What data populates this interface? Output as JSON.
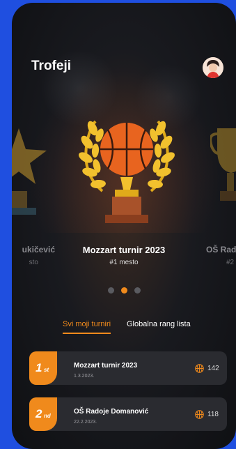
{
  "header": {
    "title": "Trofeji",
    "avatar_icon": "user-avatar-icon"
  },
  "carousel": {
    "left": {
      "title": "ukičević",
      "subtitle": "sto"
    },
    "center": {
      "title": "Mozzart turnir 2023",
      "subtitle": "#1 mesto"
    },
    "right": {
      "title": "OŠ Radoj",
      "subtitle": "#2"
    },
    "active_index": 1,
    "dot_count": 3
  },
  "tabs": {
    "my_tournaments": "Svi moji turniri",
    "global_ranking": "Globalna rang lista"
  },
  "list": [
    {
      "rank": "1",
      "suffix": "st",
      "name": "Mozzart turnir 2023",
      "date": "1.3.2023.",
      "points": "142"
    },
    {
      "rank": "2",
      "suffix": "nd",
      "name": "OŠ Radoje Domanović",
      "date": "22.2.2023.",
      "points": "118"
    }
  ],
  "colors": {
    "background": "#1f4fe0",
    "accent": "#f08a1c",
    "card": "#2a2b30"
  }
}
